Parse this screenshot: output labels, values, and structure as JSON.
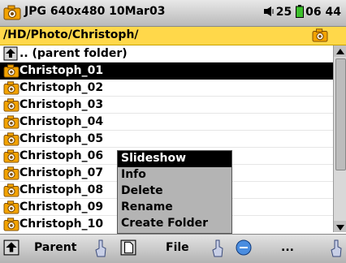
{
  "status": {
    "left_text": "JPG 640x480 10Mar03",
    "battery_text": "25",
    "time_text": "06 44"
  },
  "path": "/HD/Photo/Christoph/",
  "list": {
    "parent": ".. (parent folder)",
    "items": [
      "Christoph_01",
      "Christoph_02",
      "Christoph_03",
      "Christoph_04",
      "Christoph_05",
      "Christoph_06",
      "Christoph_07",
      "Christoph_08",
      "Christoph_09",
      "Christoph_10"
    ],
    "selected_index": 0
  },
  "context_menu": {
    "items": [
      "Slideshow",
      "Info",
      "Delete",
      "Rename",
      "Create Folder"
    ],
    "selected_index": 0
  },
  "bottom_bar": {
    "tab1": "Parent",
    "tab2": "File",
    "tab3": "..."
  },
  "icons": {
    "camera": "photo-folder-icon",
    "parent": "parent-folder-icon",
    "file": "file-icon",
    "menu": "menu-icon",
    "hand": "pointer-hand-icon"
  },
  "colors": {
    "accent": "#ffd84a",
    "selection": "#000000"
  }
}
